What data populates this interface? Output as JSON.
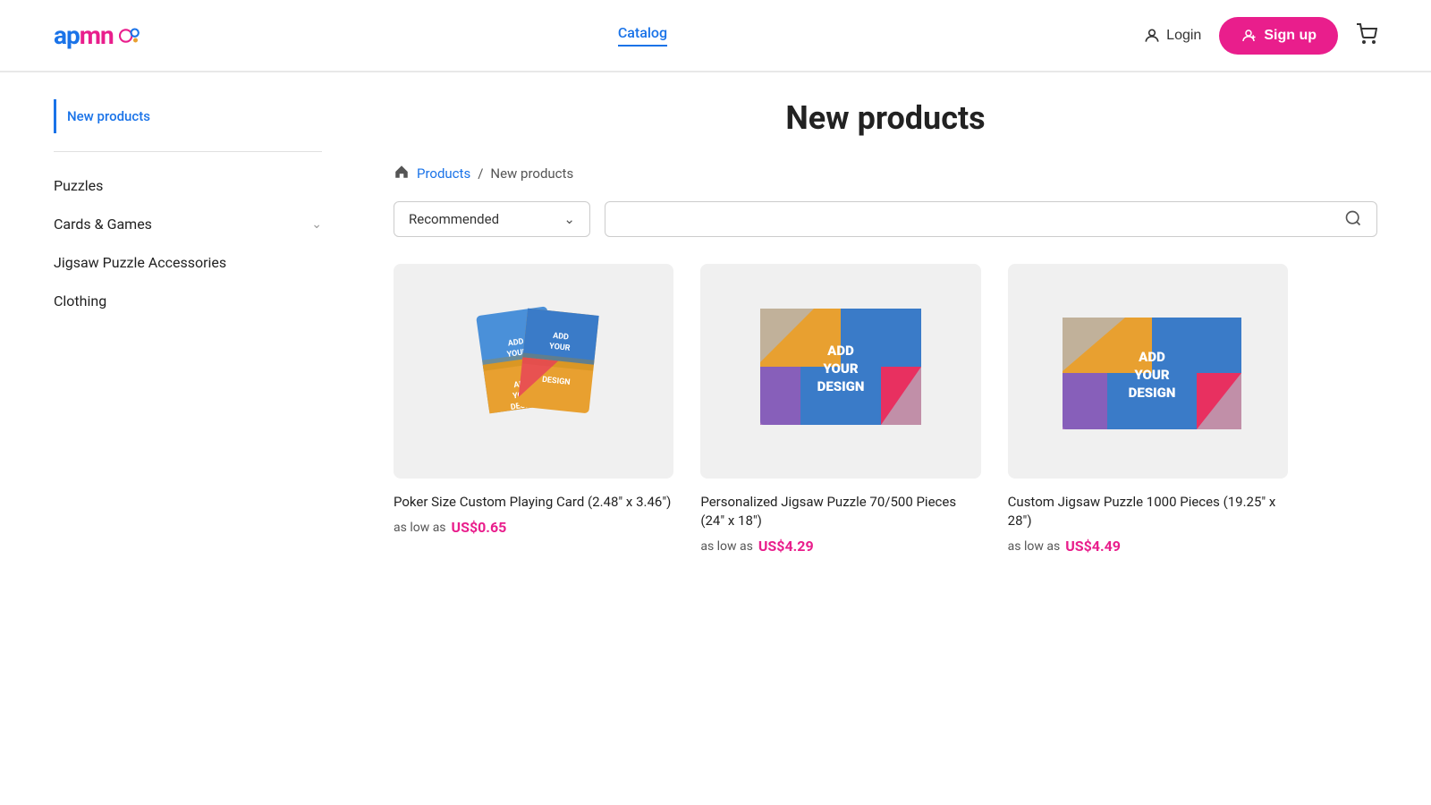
{
  "header": {
    "logo_text": "apmn",
    "nav_items": [
      {
        "label": "Catalog",
        "active": true
      }
    ],
    "login_label": "Login",
    "signup_label": "Sign up"
  },
  "sidebar": {
    "new_products_label": "New products",
    "categories": [
      {
        "label": "Puzzles",
        "has_children": false
      },
      {
        "label": "Cards & Games",
        "has_children": true
      },
      {
        "label": "Jigsaw Puzzle Accessories",
        "has_children": false
      },
      {
        "label": "Clothing",
        "has_children": false
      }
    ]
  },
  "main": {
    "page_title": "New products",
    "breadcrumb": {
      "home_icon": "home",
      "products_label": "Products",
      "current_label": "New products"
    },
    "filter": {
      "sort_label": "Recommended",
      "search_placeholder": ""
    },
    "products": [
      {
        "name": "Poker Size Custom Playing Card (2.48\" x 3.46\")",
        "price_label": "as low as",
        "price": "US$0.65",
        "type": "cards"
      },
      {
        "name": "Personalized Jigsaw Puzzle 70/500 Pieces (24\" x 18\")",
        "price_label": "as low as",
        "price": "US$4.29",
        "type": "puzzle"
      },
      {
        "name": "Custom Jigsaw Puzzle 1000 Pieces (19.25\" x 28\")",
        "price_label": "as low as",
        "price": "US$4.49",
        "type": "puzzle"
      }
    ]
  },
  "colors": {
    "accent_blue": "#1a73e8",
    "accent_pink": "#e91e8c",
    "price_color": "#e91e8c"
  }
}
